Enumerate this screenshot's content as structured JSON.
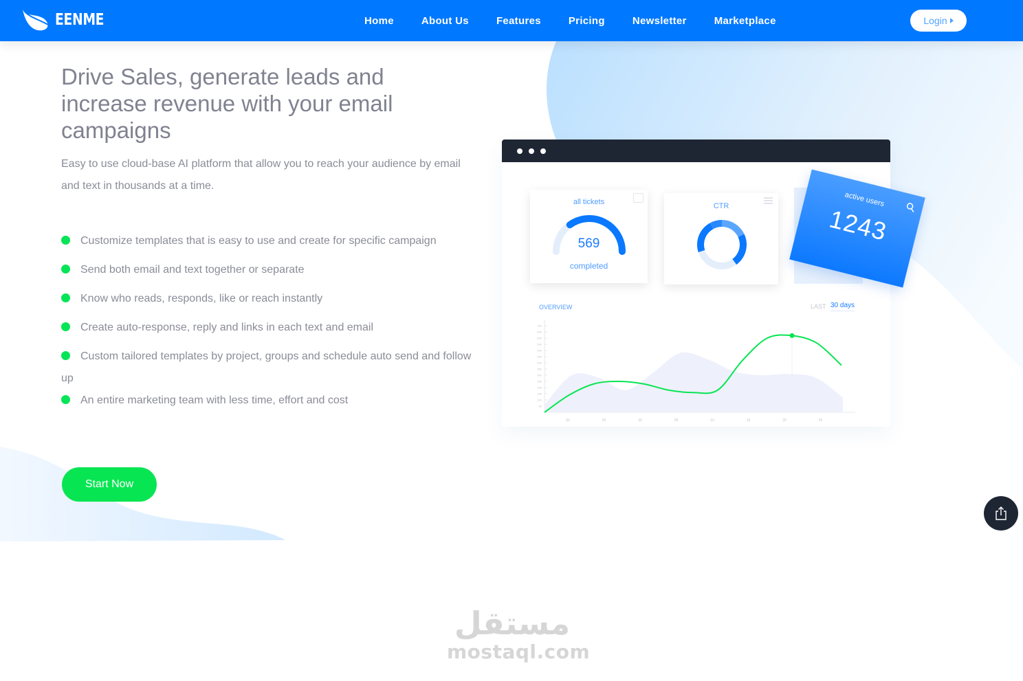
{
  "brand": {
    "name": "EENME",
    "logo_icon": "leaf-icon",
    "primary_color": "#0078ff",
    "accent_green": "#08e552"
  },
  "nav": {
    "items": [
      {
        "label": "Home"
      },
      {
        "label": "About Us"
      },
      {
        "label": "Features"
      },
      {
        "label": "Pricing"
      },
      {
        "label": "Newsletter"
      },
      {
        "label": "Marketplace"
      }
    ],
    "login_label": "Login"
  },
  "hero": {
    "title": "Drive Sales, generate leads and increase revenue with your email campaigns",
    "subtitle": "Easy to use cloud-base AI platform that allow you to reach your audience by email and text in thousands at a time.",
    "features": [
      "Customize templates that is easy to use and create for specific campaign",
      "Send both email and text together or separate",
      "Know who reads, responds, like or reach instantly",
      "Create auto-response, reply and links in each text and email",
      "Custom tailored templates by project, groups and schedule auto send and follow up",
      "An entire marketing team with less time, effort and cost"
    ],
    "cta_label": "Start Now"
  },
  "dashboard": {
    "tickets_card": {
      "title": "all tickets",
      "value": "569",
      "caption": "completed",
      "gauge_fraction": 0.7
    },
    "ctr_card": {
      "title": "CTR",
      "segments": [
        0.18,
        0.22,
        0.3,
        0.22,
        0.08
      ]
    },
    "users_card": {
      "title": "active users",
      "value": "1243"
    },
    "overview": {
      "label": "OVERVIEW",
      "range_prefix": "LAST",
      "range_value": "30 days"
    }
  },
  "chart_data": {
    "type": "line",
    "title": "OVERVIEW",
    "x_ticks": [
      "20",
      "25",
      "30",
      "05",
      "10",
      "15",
      "20",
      "25"
    ],
    "y_ticks": [
      "50",
      "100",
      "150",
      "200",
      "250",
      "300",
      "350",
      "400",
      "450",
      "500",
      "550",
      "600",
      "650",
      "700"
    ],
    "ylim": [
      0,
      750
    ],
    "series": [
      {
        "name": "line",
        "color": "#08e552",
        "values": [
          0,
          140,
          230,
          250,
          230,
          180,
          160,
          180,
          420,
          600,
          620,
          560,
          380
        ]
      },
      {
        "name": "area",
        "color": "#eef1fc",
        "values": [
          60,
          300,
          280,
          180,
          320,
          480,
          430,
          330,
          300,
          310,
          280,
          120
        ]
      }
    ],
    "highlight_index": 10,
    "grid": false,
    "legend": "none"
  },
  "share_button": {
    "icon": "share-icon"
  },
  "watermark": {
    "arabic": "مستقل",
    "latin": "mostaql.com"
  }
}
